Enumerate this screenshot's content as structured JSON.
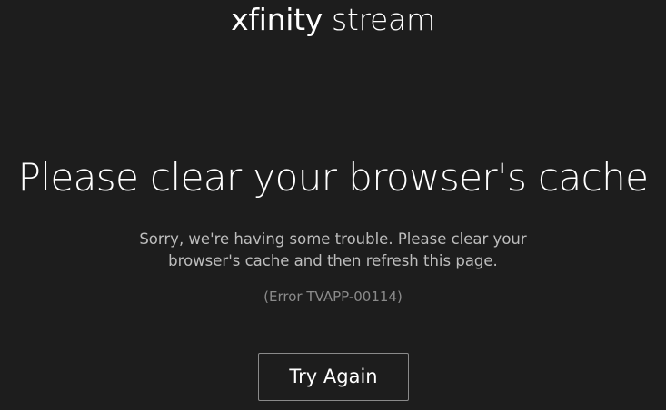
{
  "logo": {
    "brand": "xfinity",
    "product": "stream"
  },
  "error": {
    "title": "Please clear your browser's cache",
    "message": "Sorry, we're having some trouble. Please clear your browser's cache and then refresh this page.",
    "code": "(Error TVAPP-00114)"
  },
  "actions": {
    "retry_label": "Try Again"
  },
  "colors": {
    "background": "#1d1d1d",
    "title": "#ffffff",
    "message": "#bdbdbd",
    "error_code": "#8a8a8a",
    "button_border": "#8a8a8a"
  }
}
